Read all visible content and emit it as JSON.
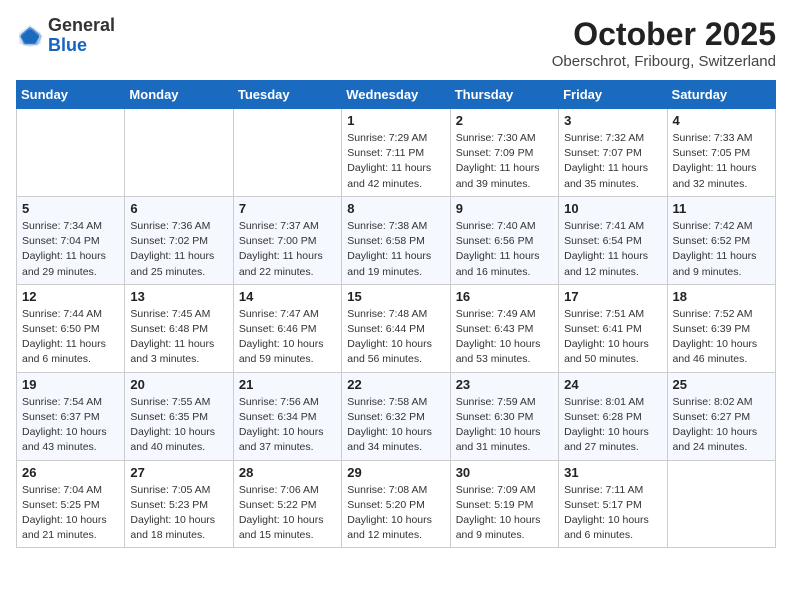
{
  "header": {
    "logo_general": "General",
    "logo_blue": "Blue",
    "month": "October 2025",
    "location": "Oberschrot, Fribourg, Switzerland"
  },
  "weekdays": [
    "Sunday",
    "Monday",
    "Tuesday",
    "Wednesday",
    "Thursday",
    "Friday",
    "Saturday"
  ],
  "weeks": [
    [
      {
        "day": "",
        "detail": ""
      },
      {
        "day": "",
        "detail": ""
      },
      {
        "day": "",
        "detail": ""
      },
      {
        "day": "1",
        "detail": "Sunrise: 7:29 AM\nSunset: 7:11 PM\nDaylight: 11 hours\nand 42 minutes."
      },
      {
        "day": "2",
        "detail": "Sunrise: 7:30 AM\nSunset: 7:09 PM\nDaylight: 11 hours\nand 39 minutes."
      },
      {
        "day": "3",
        "detail": "Sunrise: 7:32 AM\nSunset: 7:07 PM\nDaylight: 11 hours\nand 35 minutes."
      },
      {
        "day": "4",
        "detail": "Sunrise: 7:33 AM\nSunset: 7:05 PM\nDaylight: 11 hours\nand 32 minutes."
      }
    ],
    [
      {
        "day": "5",
        "detail": "Sunrise: 7:34 AM\nSunset: 7:04 PM\nDaylight: 11 hours\nand 29 minutes."
      },
      {
        "day": "6",
        "detail": "Sunrise: 7:36 AM\nSunset: 7:02 PM\nDaylight: 11 hours\nand 25 minutes."
      },
      {
        "day": "7",
        "detail": "Sunrise: 7:37 AM\nSunset: 7:00 PM\nDaylight: 11 hours\nand 22 minutes."
      },
      {
        "day": "8",
        "detail": "Sunrise: 7:38 AM\nSunset: 6:58 PM\nDaylight: 11 hours\nand 19 minutes."
      },
      {
        "day": "9",
        "detail": "Sunrise: 7:40 AM\nSunset: 6:56 PM\nDaylight: 11 hours\nand 16 minutes."
      },
      {
        "day": "10",
        "detail": "Sunrise: 7:41 AM\nSunset: 6:54 PM\nDaylight: 11 hours\nand 12 minutes."
      },
      {
        "day": "11",
        "detail": "Sunrise: 7:42 AM\nSunset: 6:52 PM\nDaylight: 11 hours\nand 9 minutes."
      }
    ],
    [
      {
        "day": "12",
        "detail": "Sunrise: 7:44 AM\nSunset: 6:50 PM\nDaylight: 11 hours\nand 6 minutes."
      },
      {
        "day": "13",
        "detail": "Sunrise: 7:45 AM\nSunset: 6:48 PM\nDaylight: 11 hours\nand 3 minutes."
      },
      {
        "day": "14",
        "detail": "Sunrise: 7:47 AM\nSunset: 6:46 PM\nDaylight: 10 hours\nand 59 minutes."
      },
      {
        "day": "15",
        "detail": "Sunrise: 7:48 AM\nSunset: 6:44 PM\nDaylight: 10 hours\nand 56 minutes."
      },
      {
        "day": "16",
        "detail": "Sunrise: 7:49 AM\nSunset: 6:43 PM\nDaylight: 10 hours\nand 53 minutes."
      },
      {
        "day": "17",
        "detail": "Sunrise: 7:51 AM\nSunset: 6:41 PM\nDaylight: 10 hours\nand 50 minutes."
      },
      {
        "day": "18",
        "detail": "Sunrise: 7:52 AM\nSunset: 6:39 PM\nDaylight: 10 hours\nand 46 minutes."
      }
    ],
    [
      {
        "day": "19",
        "detail": "Sunrise: 7:54 AM\nSunset: 6:37 PM\nDaylight: 10 hours\nand 43 minutes."
      },
      {
        "day": "20",
        "detail": "Sunrise: 7:55 AM\nSunset: 6:35 PM\nDaylight: 10 hours\nand 40 minutes."
      },
      {
        "day": "21",
        "detail": "Sunrise: 7:56 AM\nSunset: 6:34 PM\nDaylight: 10 hours\nand 37 minutes."
      },
      {
        "day": "22",
        "detail": "Sunrise: 7:58 AM\nSunset: 6:32 PM\nDaylight: 10 hours\nand 34 minutes."
      },
      {
        "day": "23",
        "detail": "Sunrise: 7:59 AM\nSunset: 6:30 PM\nDaylight: 10 hours\nand 31 minutes."
      },
      {
        "day": "24",
        "detail": "Sunrise: 8:01 AM\nSunset: 6:28 PM\nDaylight: 10 hours\nand 27 minutes."
      },
      {
        "day": "25",
        "detail": "Sunrise: 8:02 AM\nSunset: 6:27 PM\nDaylight: 10 hours\nand 24 minutes."
      }
    ],
    [
      {
        "day": "26",
        "detail": "Sunrise: 7:04 AM\nSunset: 5:25 PM\nDaylight: 10 hours\nand 21 minutes."
      },
      {
        "day": "27",
        "detail": "Sunrise: 7:05 AM\nSunset: 5:23 PM\nDaylight: 10 hours\nand 18 minutes."
      },
      {
        "day": "28",
        "detail": "Sunrise: 7:06 AM\nSunset: 5:22 PM\nDaylight: 10 hours\nand 15 minutes."
      },
      {
        "day": "29",
        "detail": "Sunrise: 7:08 AM\nSunset: 5:20 PM\nDaylight: 10 hours\nand 12 minutes."
      },
      {
        "day": "30",
        "detail": "Sunrise: 7:09 AM\nSunset: 5:19 PM\nDaylight: 10 hours\nand 9 minutes."
      },
      {
        "day": "31",
        "detail": "Sunrise: 7:11 AM\nSunset: 5:17 PM\nDaylight: 10 hours\nand 6 minutes."
      },
      {
        "day": "",
        "detail": ""
      }
    ]
  ]
}
